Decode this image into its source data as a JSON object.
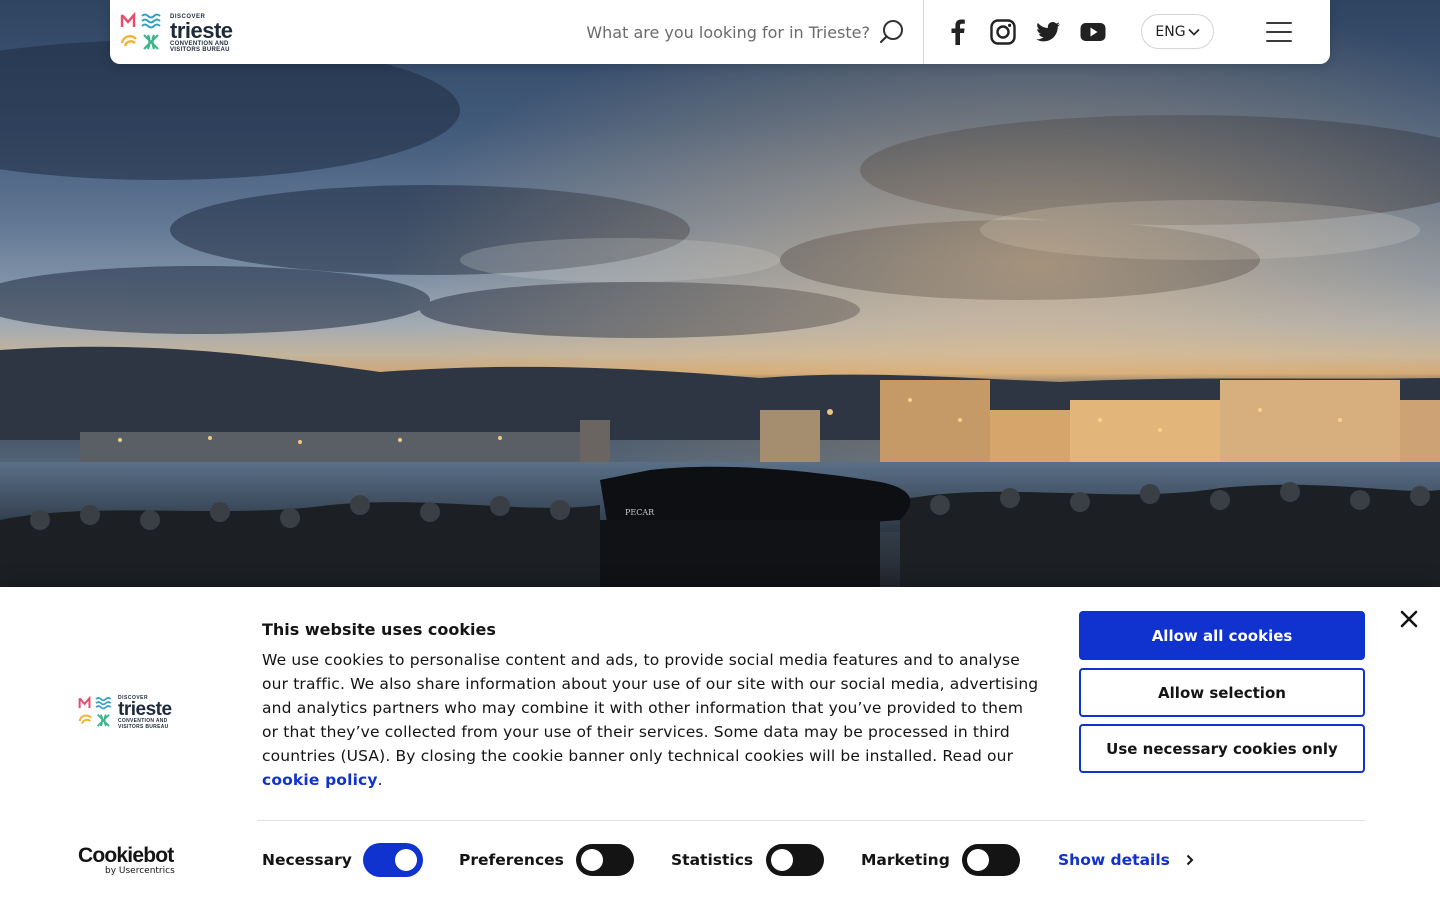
{
  "header": {
    "logo": {
      "small": "DISCOVER",
      "big": "trieste",
      "sub1": "CONVENTION AND",
      "sub2": "VISITORS BUREAU"
    },
    "search_placeholder": "What are you looking for in Trieste?",
    "social": [
      "facebook-icon",
      "instagram-icon",
      "twitter-icon",
      "youtube-icon"
    ],
    "language": "ENG"
  },
  "hero": {
    "description": "",
    "piano_label": "PECAR"
  },
  "cookie_banner": {
    "title": "This website uses cookies",
    "body": "We use cookies to personalise content and ads, to provide social media features and to analyse our traffic. We also share information about your use of our site with our social media, advertising and analytics partners who may combine it with other information that you’ve provided to them or that they’ve collected from your use of their services. Some data may be processed in third countries (USA). By closing the cookie banner only technical cookies will be installed. Read our ",
    "link_text": "cookie policy",
    "after_link": ".",
    "buttons": {
      "allow_all": "Allow all cookies",
      "allow_selection": "Allow selection",
      "necessary_only": "Use necessary cookies only"
    },
    "toggles": [
      {
        "label": "Necessary",
        "on": true
      },
      {
        "label": "Preferences",
        "on": false
      },
      {
        "label": "Statistics",
        "on": false
      },
      {
        "label": "Marketing",
        "on": false
      }
    ],
    "show_details": "Show details",
    "cookiebot": {
      "name": "Cookiebot",
      "by": "by Usercentrics"
    }
  },
  "colors": {
    "accent": "#1032cf",
    "toggle_off": "#141414",
    "text": "#141414"
  }
}
